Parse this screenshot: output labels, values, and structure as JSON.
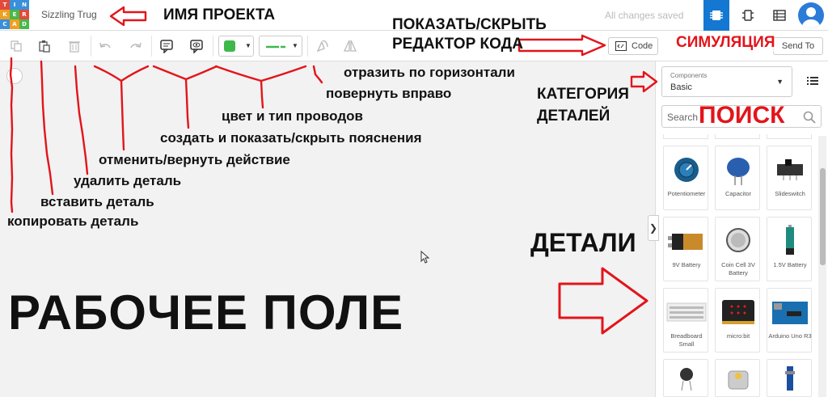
{
  "header": {
    "logo_letters": [
      "T",
      "I",
      "N",
      "K",
      "E",
      "R",
      "C",
      "A",
      "D"
    ],
    "project_name": "Sizzling Trug",
    "save_status": "All changes saved",
    "views": [
      "circuit-view-icon",
      "schematic-view-icon",
      "component-list-icon"
    ]
  },
  "toolbar": {
    "buttons": [
      "copy-icon",
      "paste-icon",
      "delete-icon",
      "undo-icon",
      "redo-icon",
      "notes-icon",
      "toggle-notes-icon"
    ],
    "wire_color": "#3fb84a",
    "code_label": "Code",
    "send_label": "Send To"
  },
  "components_panel": {
    "category_label": "Components",
    "category_value": "Basic",
    "search_placeholder": "Search",
    "items": [
      {
        "name": "Potentiometer"
      },
      {
        "name": "Capacitor"
      },
      {
        "name": "Slideswitch"
      },
      {
        "name": "9V Battery"
      },
      {
        "name": "Coin Cell 3V Battery"
      },
      {
        "name": "1.5V Battery"
      },
      {
        "name": "Breadboard Small"
      },
      {
        "name": "micro:bit"
      },
      {
        "name": "Arduino Uno R3"
      }
    ]
  },
  "annotations": {
    "project_name": "ИМЯ ПРОЕКТА",
    "code_editor_line1": "ПОКАЗАТЬ/СКРЫТЬ",
    "code_editor_line2": "РЕДАКТОР КОДА",
    "simulation": "СИМУЛЯЦИЯ",
    "flip": "отразить по горизонтали",
    "rotate": "повернуть вправо",
    "category_line1": "КАТЕГОРИЯ",
    "category_line2": "ДЕТАЛЕЙ",
    "search": "ПОИСК",
    "wires": "цвет и тип проводов",
    "notes": "создать и показать/скрыть пояснения",
    "undo_redo": "отменить/вернуть действие",
    "delete": "удалить деталь",
    "paste": "вставить деталь",
    "copy": "копировать деталь",
    "parts": "ДЕТАЛИ",
    "workplane": "РАБОЧЕЕ ПОЛЕ"
  },
  "colors": {
    "accent": "#1477d1",
    "annotation_red": "#e3141b",
    "workplane_bg": "#f2f2f2"
  }
}
